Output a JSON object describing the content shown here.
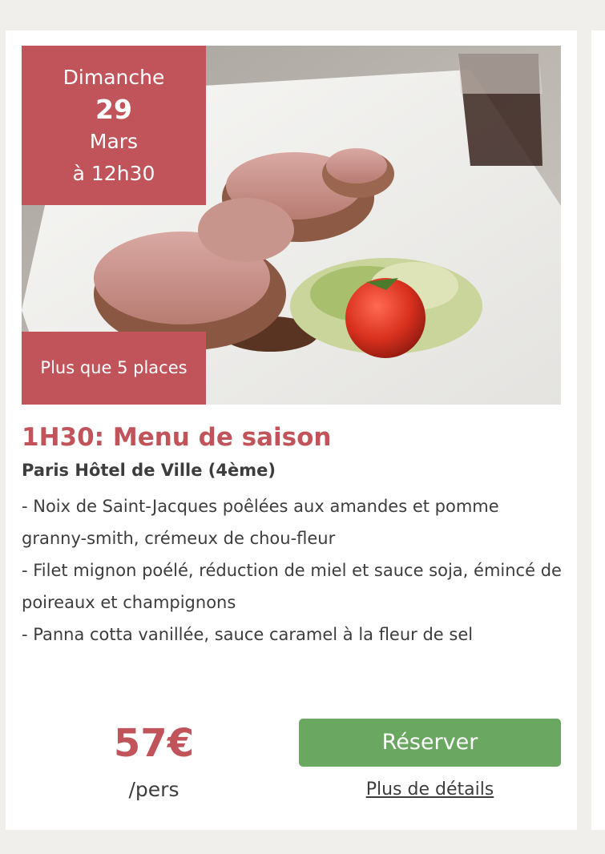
{
  "event": {
    "day_name": "Dimanche",
    "day_number": "29",
    "month": "Mars",
    "time": "à 12h30",
    "availability": "Plus que 5 places"
  },
  "course": {
    "title": "1H30: Menu de saison",
    "location": "Paris Hôtel de Ville (4ème)",
    "menu_items": [
      "- Noix de Saint-Jacques poêlées aux amandes et pomme granny-smith, crémeux de chou-fleur",
      "- Filet mignon poélé, réduction de miel et sauce soja, émincé de poireaux et champignons",
      "- Panna cotta vanillée, sauce caramel à la fleur de sel"
    ]
  },
  "pricing": {
    "price": "57€",
    "unit": "/pers"
  },
  "actions": {
    "reserve_label": "Réserver",
    "details_label": "Plus de détails"
  },
  "image": {
    "subject": "plated-pork-filet-mignon-photo"
  },
  "colors": {
    "accent": "#c0545a",
    "button": "#6aa760",
    "text": "#3d3d3d",
    "background": "#f1efec"
  }
}
